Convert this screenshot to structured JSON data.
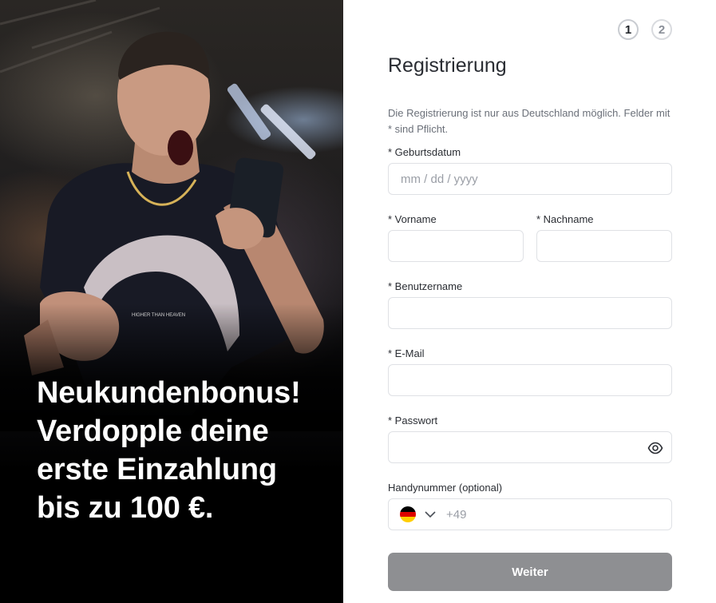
{
  "promo": {
    "headline_lines": [
      "Neukundenbonus!",
      "Verdopple deine",
      "erste Einzahlung",
      "bis zu 100 €."
    ]
  },
  "steps": [
    {
      "label": "1",
      "state": "active"
    },
    {
      "label": "2",
      "state": "inactive"
    }
  ],
  "form": {
    "title": "Registrierung",
    "note": "Die Registrierung ist nur aus Deutschland möglich. Felder mit * sind Pflicht.",
    "birthdate": {
      "label": "* Geburtsdatum",
      "placeholder": "mm / dd / yyyy",
      "value": ""
    },
    "firstname": {
      "label": "* Vorname",
      "value": ""
    },
    "lastname": {
      "label": "* Nachname",
      "value": ""
    },
    "username": {
      "label": "* Benutzername",
      "value": ""
    },
    "email": {
      "label": "* E-Mail",
      "value": ""
    },
    "password": {
      "label": "* Passwort",
      "value": "",
      "toggle_icon": "eye-icon"
    },
    "phone": {
      "label": "Handynummer (optional)",
      "country_icon": "germany-flag-icon",
      "prefix": "+49",
      "value": ""
    },
    "submit_label": "Weiter"
  },
  "colors": {
    "submit_bg": "#8e8f92",
    "border": "#dfe1e5",
    "promo_bg": "#000000"
  }
}
